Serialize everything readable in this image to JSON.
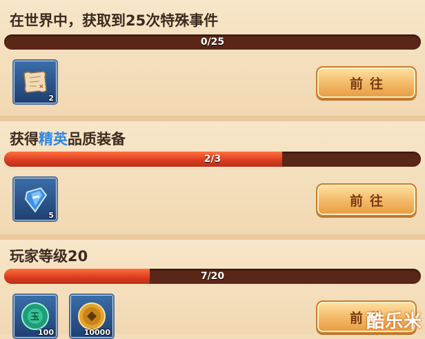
{
  "tasks": [
    {
      "title": "在世界中，获取到25次特殊事件",
      "progress_text": "0/25",
      "progress": 0.0,
      "button_label": "前往",
      "rewards": [
        {
          "icon": "treasure-map-icon",
          "count": "2"
        }
      ]
    },
    {
      "title_before": "获得",
      "title_highlight": "精英",
      "title_after": "品质装备",
      "progress_text": "2/3",
      "progress": 0.667,
      "button_label": "前往",
      "rewards": [
        {
          "icon": "blue-gem-icon",
          "count": "5"
        }
      ]
    },
    {
      "title": "玩家等级20",
      "progress_text": "7/20",
      "progress": 0.35,
      "button_label": "前往",
      "rewards": [
        {
          "icon": "jade-token-icon",
          "count": "100"
        },
        {
          "icon": "gold-coin-icon",
          "count": "10000"
        }
      ]
    }
  ],
  "watermark": "酷乐米",
  "colors": {
    "highlight": "#2f86e6",
    "bar_fill": "#d93a1f",
    "bar_track": "#5a2618"
  }
}
